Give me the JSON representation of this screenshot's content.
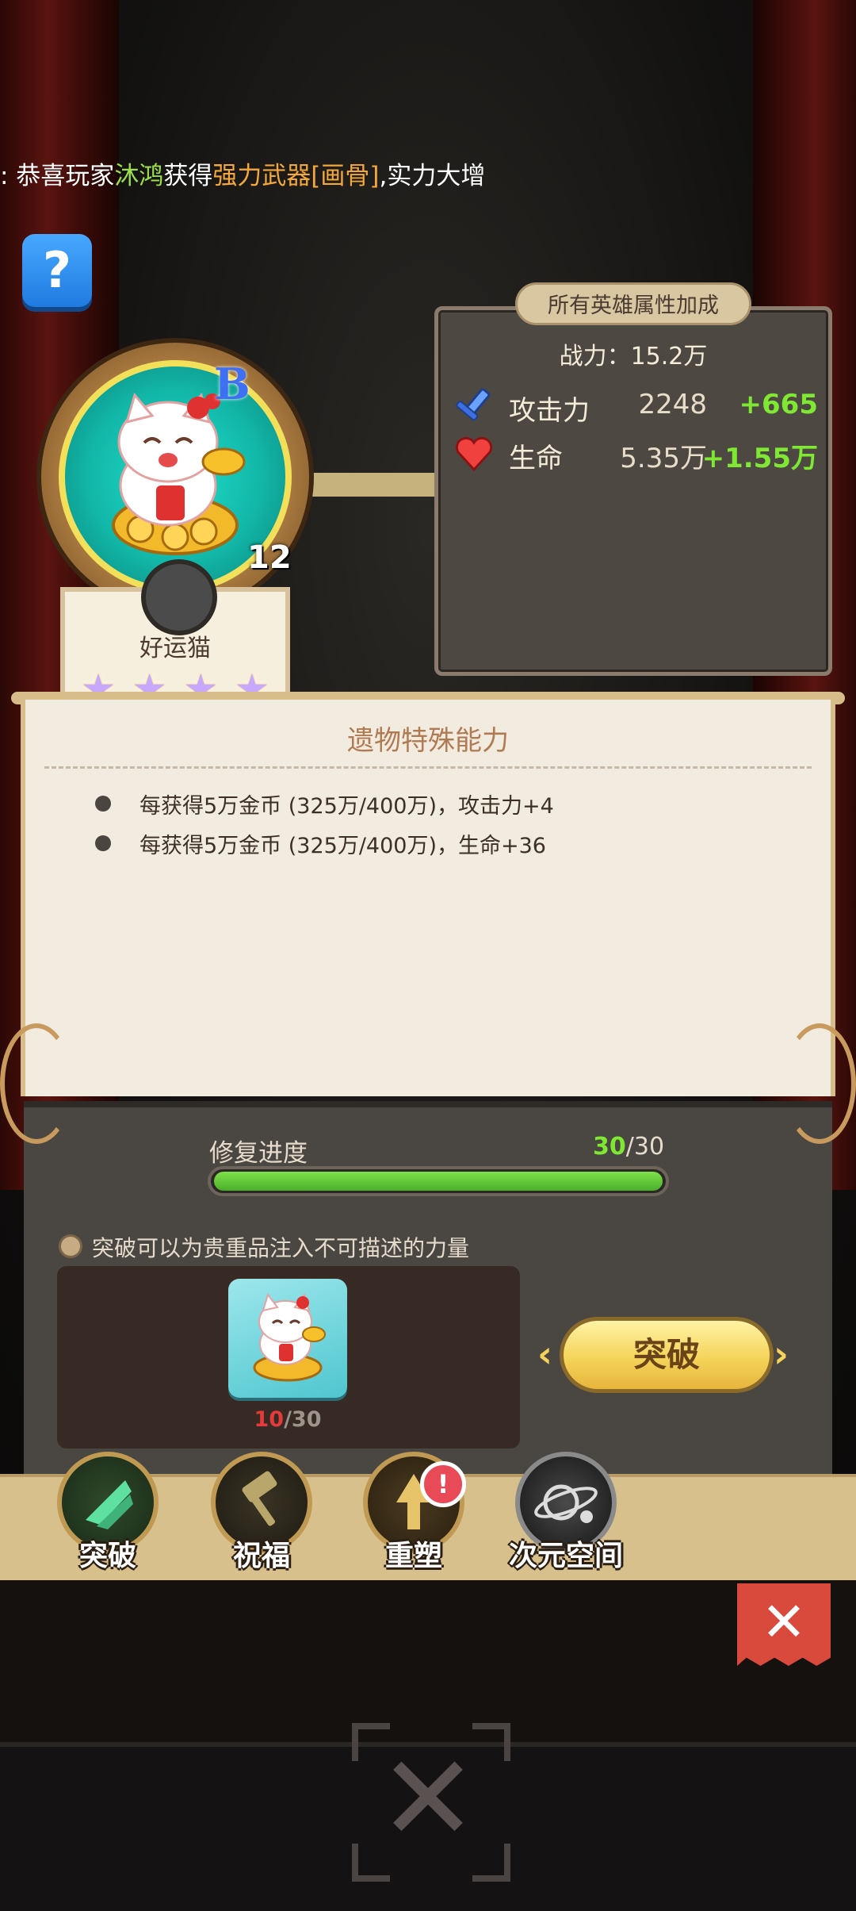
{
  "ticker": {
    "prefix": ": 恭喜玩家",
    "player": "沐鸿",
    "mid": "获得",
    "item": "强力武器[画骨]",
    "suffix": ",实力大增"
  },
  "help_icon": "?",
  "relic": {
    "grade": "B",
    "level": "12",
    "name": "好运猫",
    "stars": 4,
    "icon": "lucky-cat-icon"
  },
  "stats": {
    "title": "所有英雄属性加成",
    "power_label": "战力：15.2万",
    "rows": [
      {
        "icon": "sword-icon",
        "label": "攻击力",
        "value": "2248",
        "bonus": "+665"
      },
      {
        "icon": "heart-icon",
        "label": "生命",
        "value": "5.35万",
        "bonus": "+1.55万"
      }
    ]
  },
  "ability": {
    "title": "遗物特殊能力",
    "lines": [
      "每获得5万金币 (325万/400万)，攻击力+4",
      "每获得5万金币 (325万/400万)，生命+36"
    ]
  },
  "repair": {
    "label": "修复进度",
    "current": "30",
    "total": "/30",
    "progress": 1.0
  },
  "hint": "突破可以为贵重品注入不可描述的力量",
  "material": {
    "current": "10",
    "total": "/30"
  },
  "break_button": "突破",
  "tabs": [
    {
      "label": "突破",
      "icon": "breakthrough-icon"
    },
    {
      "label": "祝福",
      "icon": "hammer-icon"
    },
    {
      "label": "重塑",
      "icon": "reshape-icon"
    },
    {
      "label": "次元空间",
      "icon": "dimension-icon"
    }
  ],
  "badge": "!",
  "colors": {
    "accent_green": "#7ee832",
    "alert_red": "#e94a57",
    "button_gold": "#f4d45a"
  }
}
